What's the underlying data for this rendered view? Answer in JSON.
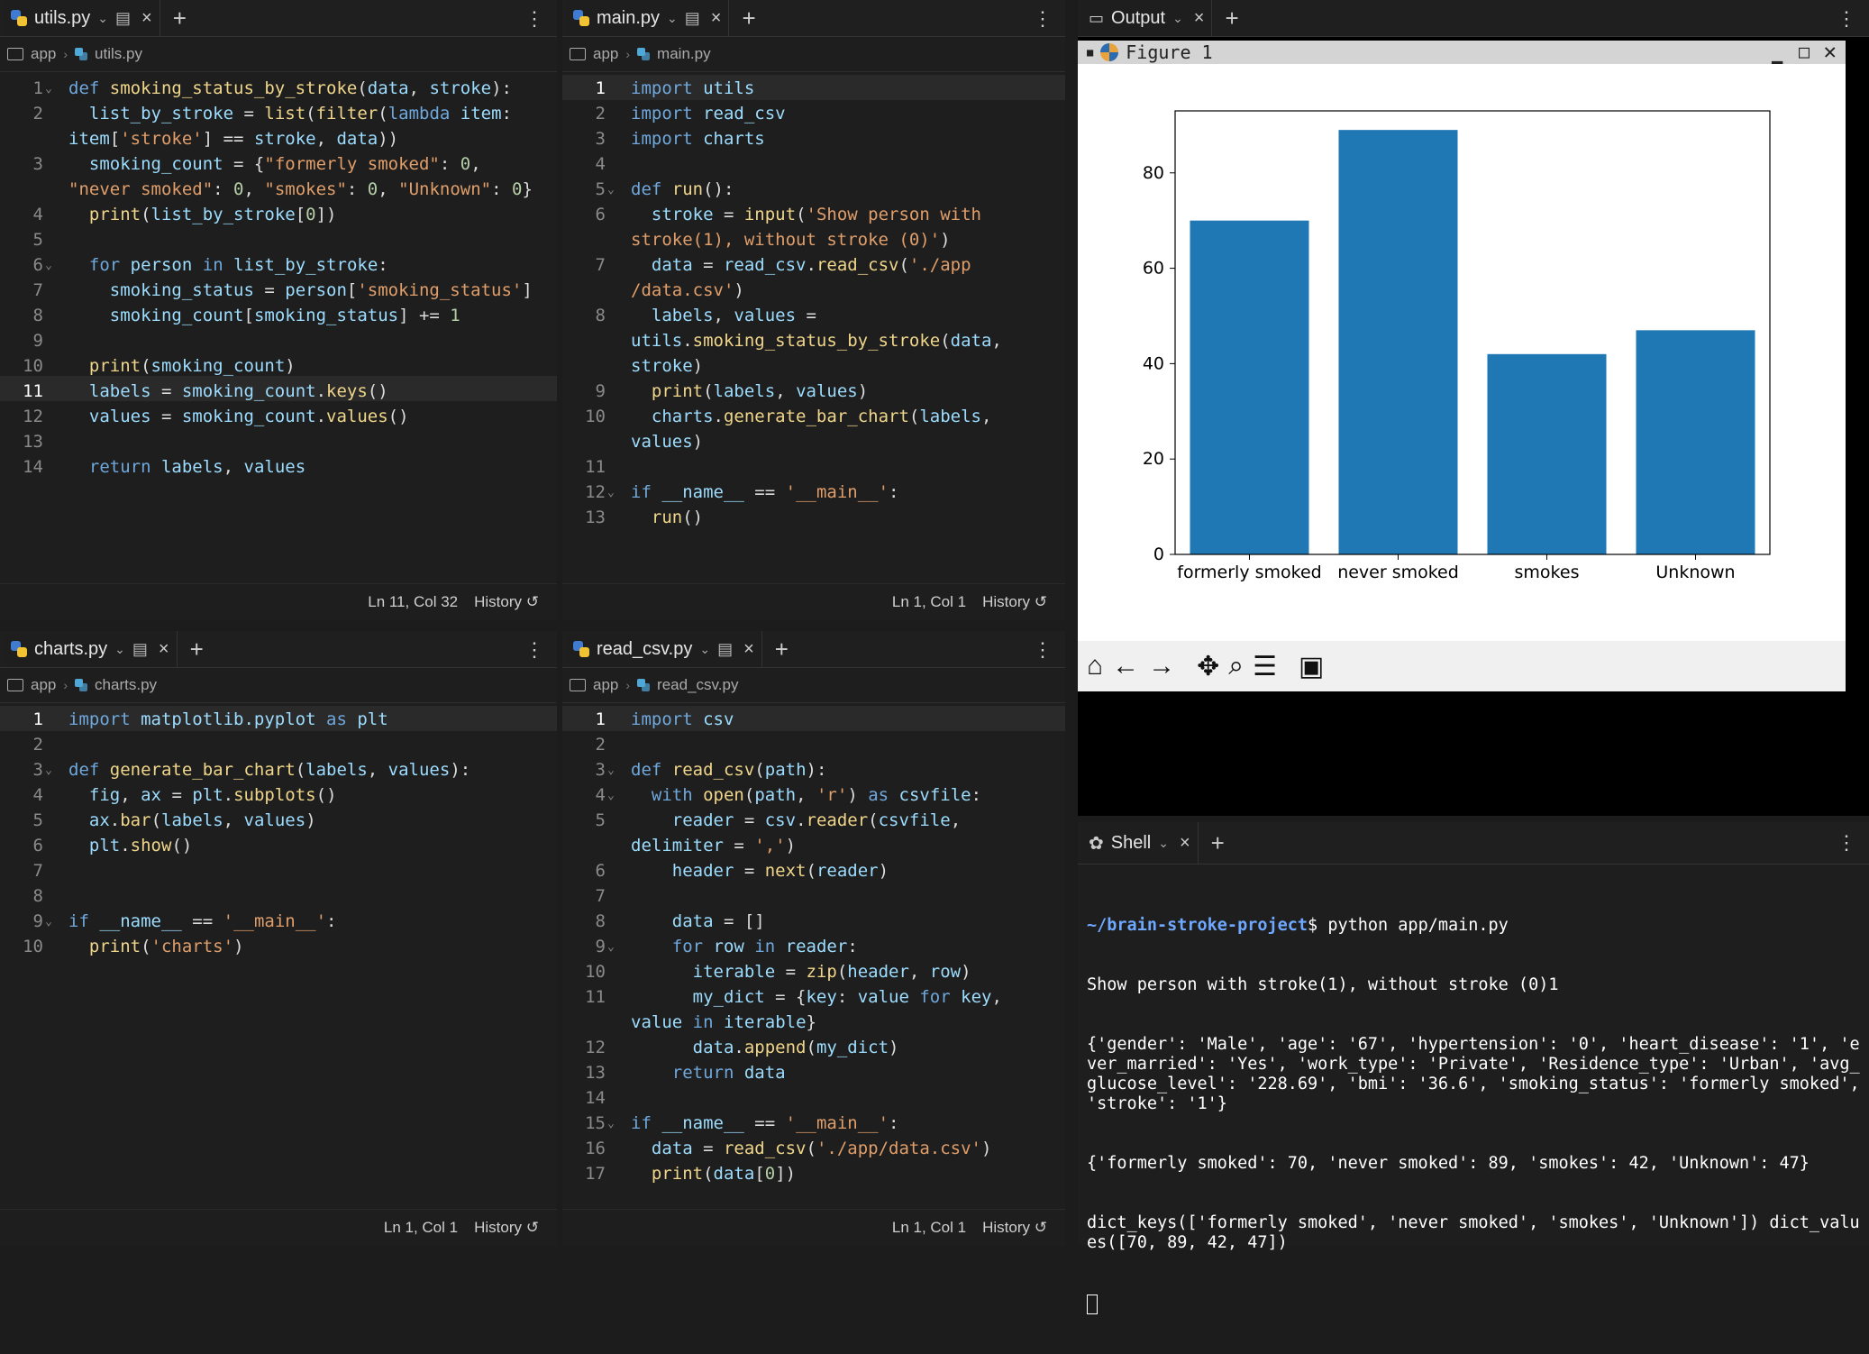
{
  "panes": {
    "utils": {
      "tab": "utils.py",
      "crumb_root": "app",
      "crumb_file": "utils.py",
      "status_pos": "Ln 11, Col 32",
      "history": "History"
    },
    "main": {
      "tab": "main.py",
      "crumb_root": "app",
      "crumb_file": "main.py",
      "status_pos": "Ln 1, Col 1",
      "history": "History"
    },
    "charts": {
      "tab": "charts.py",
      "crumb_root": "app",
      "crumb_file": "charts.py",
      "status_pos": "Ln 1, Col 1",
      "history": "History"
    },
    "readcsv": {
      "tab": "read_csv.py",
      "crumb_root": "app",
      "crumb_file": "read_csv.py",
      "status_pos": "Ln 1, Col 1",
      "history": "History"
    }
  },
  "output": {
    "tab": "Output",
    "figure_title": "Figure 1"
  },
  "shell": {
    "tab": "Shell",
    "prompt_path": "~/brain-stroke-project",
    "command": "$ python app/main.py",
    "lines": [
      "Show person with stroke(1), without stroke (0)1",
      "{'gender': 'Male', 'age': '67', 'hypertension': '0', 'heart_disease': '1', 'ever_married': 'Yes', 'work_type': 'Private', 'Residence_type': 'Urban', 'avg_glucose_level': '228.69', 'bmi': '36.6', 'smoking_status': 'formerly smoked', 'stroke': '1'}",
      "{'formerly smoked': 70, 'never smoked': 89, 'smokes': 42, 'Unknown': 47}",
      "dict_keys(['formerly smoked', 'never smoked', 'smokes', 'Unknown']) dict_values([70, 89, 42, 47])"
    ]
  },
  "chart_data": {
    "type": "bar",
    "categories": [
      "formerly smoked",
      "never smoked",
      "smokes",
      "Unknown"
    ],
    "values": [
      70,
      89,
      42,
      47
    ],
    "title": "",
    "xlabel": "",
    "ylabel": "",
    "ylim": [
      0,
      93
    ],
    "yticks": [
      0,
      20,
      40,
      60,
      80
    ],
    "color": "#1f77b4"
  }
}
